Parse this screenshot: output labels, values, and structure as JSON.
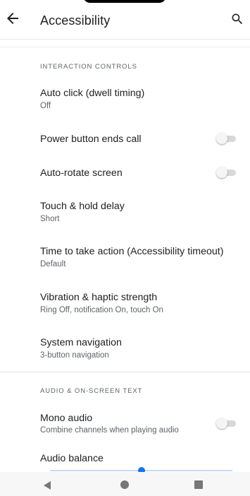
{
  "toolbar": {
    "title": "Accessibility",
    "back_icon": "arrow-back-icon",
    "search_icon": "search-icon"
  },
  "sections": {
    "interaction_header": "INTERACTION CONTROLS",
    "audio_header": "AUDIO & ON-SCREEN TEXT"
  },
  "settings": {
    "auto_click": {
      "title": "Auto click (dwell timing)",
      "summary": "Off"
    },
    "power_button": {
      "title": "Power button ends call",
      "enabled": false
    },
    "auto_rotate": {
      "title": "Auto-rotate screen",
      "enabled": false
    },
    "touch_hold": {
      "title": "Touch & hold delay",
      "summary": "Short"
    },
    "time_to_act": {
      "title": "Time to take action (Accessibility timeout)",
      "summary": "Default"
    },
    "vibration": {
      "title": "Vibration & haptic strength",
      "summary": "Ring Off, notification On, touch On"
    },
    "system_nav": {
      "title": "System navigation",
      "summary": "3-button navigation"
    },
    "mono_audio": {
      "title": "Mono audio",
      "summary": "Combine channels when playing audio",
      "enabled": false
    },
    "audio_balance": {
      "title": "Audio balance",
      "value_fraction": 0.5
    }
  },
  "navbar": {
    "back": "nav-back-icon",
    "home": "nav-home-icon",
    "recents": "nav-recents-icon"
  },
  "colors": {
    "accent": "#1a73e8",
    "text_primary": "#202124",
    "text_secondary": "#5f6368"
  }
}
